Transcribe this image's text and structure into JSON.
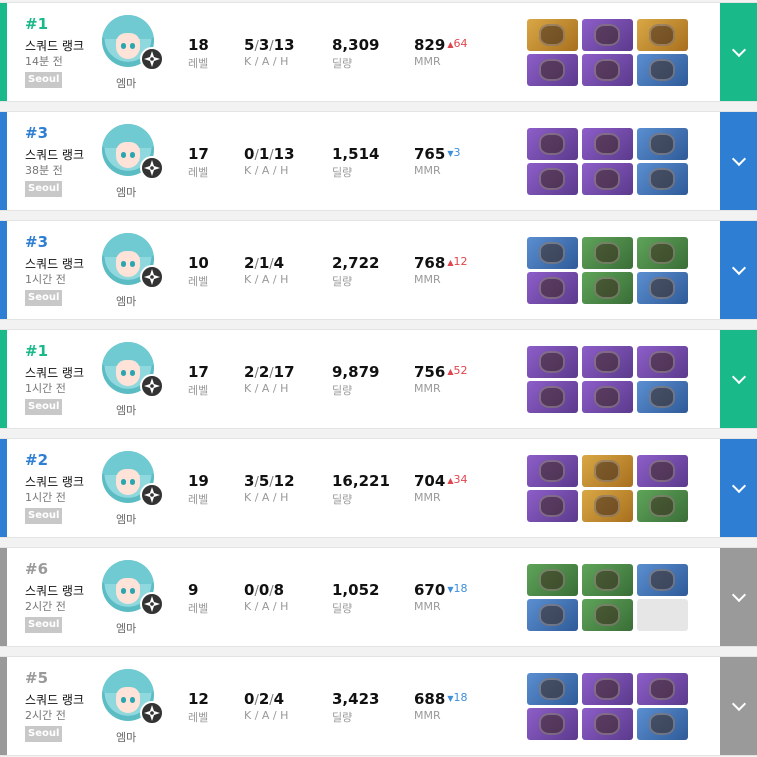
{
  "labels": {
    "level": "레벨",
    "kah": "K / A / H",
    "damage": "딜량",
    "mmr": "MMR",
    "sep": "/"
  },
  "colors": {
    "green": "#19b98a",
    "blue": "#2e7fd3",
    "gray": "#9a9a9a",
    "up": "#e0444c",
    "down": "#3f8fd9"
  },
  "matches": [
    {
      "rank": "#1",
      "tier": "green",
      "mode": "스쿼드 랭크",
      "ago": "14분 전",
      "server": "Seoul",
      "character": "엠마",
      "level": "18",
      "k": "5",
      "a": "3",
      "h": "13",
      "damage": "8,309",
      "mmr": "829",
      "delta": "64",
      "dir": "up",
      "items": [
        "orange",
        "purple",
        "orange",
        "purple",
        "purple",
        "blue"
      ]
    },
    {
      "rank": "#3",
      "tier": "blue",
      "mode": "스쿼드 랭크",
      "ago": "38분 전",
      "server": "Seoul",
      "character": "엠마",
      "level": "17",
      "k": "0",
      "a": "1",
      "h": "13",
      "damage": "1,514",
      "mmr": "765",
      "delta": "3",
      "dir": "down",
      "items": [
        "purple",
        "purple",
        "blue",
        "purple",
        "purple",
        "blue"
      ]
    },
    {
      "rank": "#3",
      "tier": "blue",
      "mode": "스쿼드 랭크",
      "ago": "1시간 전",
      "server": "Seoul",
      "character": "엠마",
      "level": "10",
      "k": "2",
      "a": "1",
      "h": "4",
      "damage": "2,722",
      "mmr": "768",
      "delta": "12",
      "dir": "up",
      "items": [
        "blue",
        "green",
        "green",
        "purple",
        "green",
        "blue"
      ]
    },
    {
      "rank": "#1",
      "tier": "green",
      "mode": "스쿼드 랭크",
      "ago": "1시간 전",
      "server": "Seoul",
      "character": "엠마",
      "level": "17",
      "k": "2",
      "a": "2",
      "h": "17",
      "damage": "9,879",
      "mmr": "756",
      "delta": "52",
      "dir": "up",
      "items": [
        "purple",
        "purple",
        "purple",
        "purple",
        "purple",
        "blue"
      ]
    },
    {
      "rank": "#2",
      "tier": "blue",
      "mode": "스쿼드 랭크",
      "ago": "1시간 전",
      "server": "Seoul",
      "character": "엠마",
      "level": "19",
      "k": "3",
      "a": "5",
      "h": "12",
      "damage": "16,221",
      "mmr": "704",
      "delta": "34",
      "dir": "up",
      "items": [
        "purple",
        "orange",
        "purple",
        "purple",
        "orange",
        "green"
      ]
    },
    {
      "rank": "#6",
      "tier": "gray",
      "mode": "스쿼드 랭크",
      "ago": "2시간 전",
      "server": "Seoul",
      "character": "엠마",
      "level": "9",
      "k": "0",
      "a": "0",
      "h": "8",
      "damage": "1,052",
      "mmr": "670",
      "delta": "18",
      "dir": "down",
      "items": [
        "green",
        "green",
        "blue",
        "blue",
        "green",
        "empty"
      ]
    },
    {
      "rank": "#5",
      "tier": "gray",
      "mode": "스쿼드 랭크",
      "ago": "2시간 전",
      "server": "Seoul",
      "character": "엠마",
      "level": "12",
      "k": "0",
      "a": "2",
      "h": "4",
      "damage": "3,423",
      "mmr": "688",
      "delta": "18",
      "dir": "down",
      "items": [
        "blue",
        "purple",
        "purple",
        "purple",
        "purple",
        "blue"
      ]
    }
  ]
}
